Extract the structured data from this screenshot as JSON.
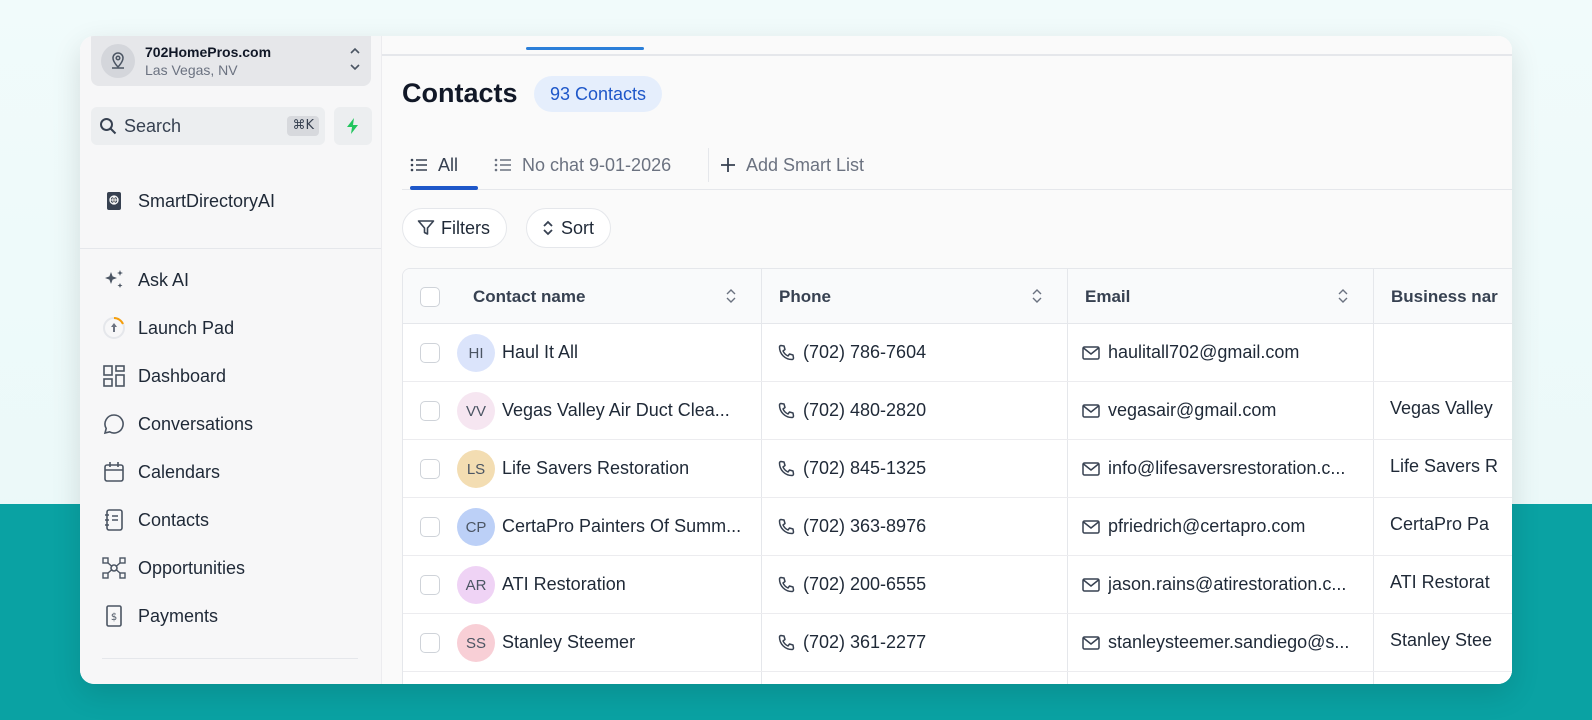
{
  "location": {
    "name": "702HomePros.com",
    "city": "Las Vegas, NV"
  },
  "search": {
    "label": "Search",
    "shortcut": "⌘K"
  },
  "sidebar": {
    "directory_item": "SmartDirectoryAI",
    "items": [
      {
        "label": "Ask AI",
        "icon": "sparkles-icon"
      },
      {
        "label": "Launch Pad",
        "icon": "rocket-icon"
      },
      {
        "label": "Dashboard",
        "icon": "dashboard-icon"
      },
      {
        "label": "Conversations",
        "icon": "chat-icon"
      },
      {
        "label": "Calendars",
        "icon": "calendar-icon"
      },
      {
        "label": "Contacts",
        "icon": "contacts-icon"
      },
      {
        "label": "Opportunities",
        "icon": "opportunities-icon"
      },
      {
        "label": "Payments",
        "icon": "payments-icon"
      }
    ]
  },
  "page": {
    "title": "Contacts",
    "count_label": "93 Contacts"
  },
  "tabs": [
    {
      "label": "All",
      "active": true
    },
    {
      "label": "No chat 9-01-2026",
      "active": false
    }
  ],
  "add_smart_list": "Add Smart List",
  "toolbar": {
    "filters": "Filters",
    "sort": "Sort"
  },
  "table": {
    "columns": [
      "Contact name",
      "Phone",
      "Email",
      "Business nar"
    ],
    "rows": [
      {
        "initials": "HI",
        "avatar_color": "#dbe4fb",
        "name": "Haul It All",
        "phone": "(702) 786-7604",
        "email": "haulitall702@gmail.com",
        "business": ""
      },
      {
        "initials": "VV",
        "avatar_color": "#f6e6f1",
        "name": "Vegas Valley Air Duct Clea...",
        "phone": "(702) 480-2820",
        "email": "vegasair@gmail.com",
        "business": "Vegas Valley"
      },
      {
        "initials": "LS",
        "avatar_color": "#f3ddb2",
        "name": "Life Savers Restoration",
        "phone": "(702) 845-1325",
        "email": "info@lifesaversrestoration.c...",
        "business": "Life Savers R"
      },
      {
        "initials": "CP",
        "avatar_color": "#bcd0f7",
        "name": "CertaPro Painters Of Summ...",
        "phone": "(702) 363-8976",
        "email": "pfriedrich@certapro.com",
        "business": "CertaPro Pa"
      },
      {
        "initials": "AR",
        "avatar_color": "#efd3f5",
        "name": "ATI Restoration",
        "phone": "(702) 200-6555",
        "email": "jason.rains@atirestoration.c...",
        "business": "ATI Restorat"
      },
      {
        "initials": "SS",
        "avatar_color": "#f8cfd6",
        "name": "Stanley Steemer",
        "phone": "(702) 361-2277",
        "email": "stanleysteemer.sandiego@s...",
        "business": "Stanley Stee"
      }
    ]
  },
  "colors": {
    "accent": "#1e57c9",
    "teal_background": "#0aa2a3",
    "bolt": "#22c55e"
  }
}
